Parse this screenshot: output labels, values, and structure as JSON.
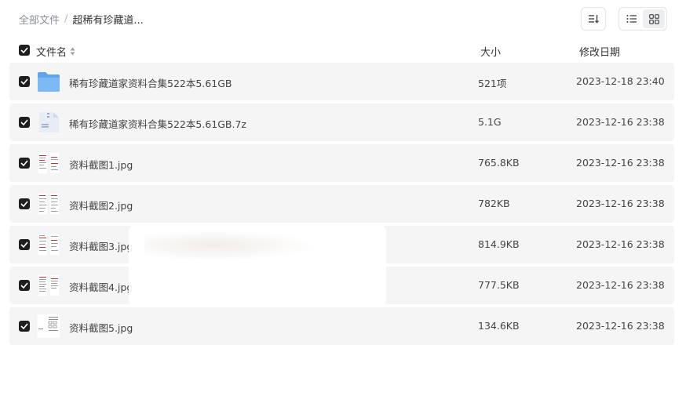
{
  "breadcrumb": {
    "root": "全部文件",
    "separator": "/",
    "current": "超稀有珍藏道..."
  },
  "toolbar": {
    "sort_icon": "sort-icon",
    "list_view_icon": "list-view-icon",
    "grid_view_icon": "grid-view-icon",
    "active_view": "grid"
  },
  "columns": {
    "name": "文件名",
    "size": "大小",
    "date": "修改日期"
  },
  "files": [
    {
      "name": "稀有珍藏道家资料合集522本5.61GB",
      "size": "521项",
      "date": "2023-12-18 23:40",
      "type": "folder",
      "checked": true
    },
    {
      "name": "稀有珍藏道家资料合集522本5.61GB.7z",
      "size": "5.1G",
      "date": "2023-12-16 23:38",
      "type": "archive",
      "checked": true
    },
    {
      "name": "资料截图1.jpg",
      "size": "765.8KB",
      "date": "2023-12-16 23:38",
      "type": "image",
      "checked": true
    },
    {
      "name": "资料截图2.jpg",
      "size": "782KB",
      "date": "2023-12-16 23:38",
      "type": "image",
      "checked": true
    },
    {
      "name": "资料截图3.jpg",
      "size": "814.9KB",
      "date": "2023-12-16 23:38",
      "type": "image",
      "checked": true
    },
    {
      "name": "资料截图4.jpg",
      "size": "777.5KB",
      "date": "2023-12-16 23:38",
      "type": "image",
      "checked": true
    },
    {
      "name": "资料截图5.jpg",
      "size": "134.6KB",
      "date": "2023-12-16 23:38",
      "type": "image-alt",
      "checked": true
    }
  ],
  "colors": {
    "checkbox": "#1f1f1f",
    "row_bg": "#f5f5f6",
    "folder": "#6fb1f2"
  }
}
